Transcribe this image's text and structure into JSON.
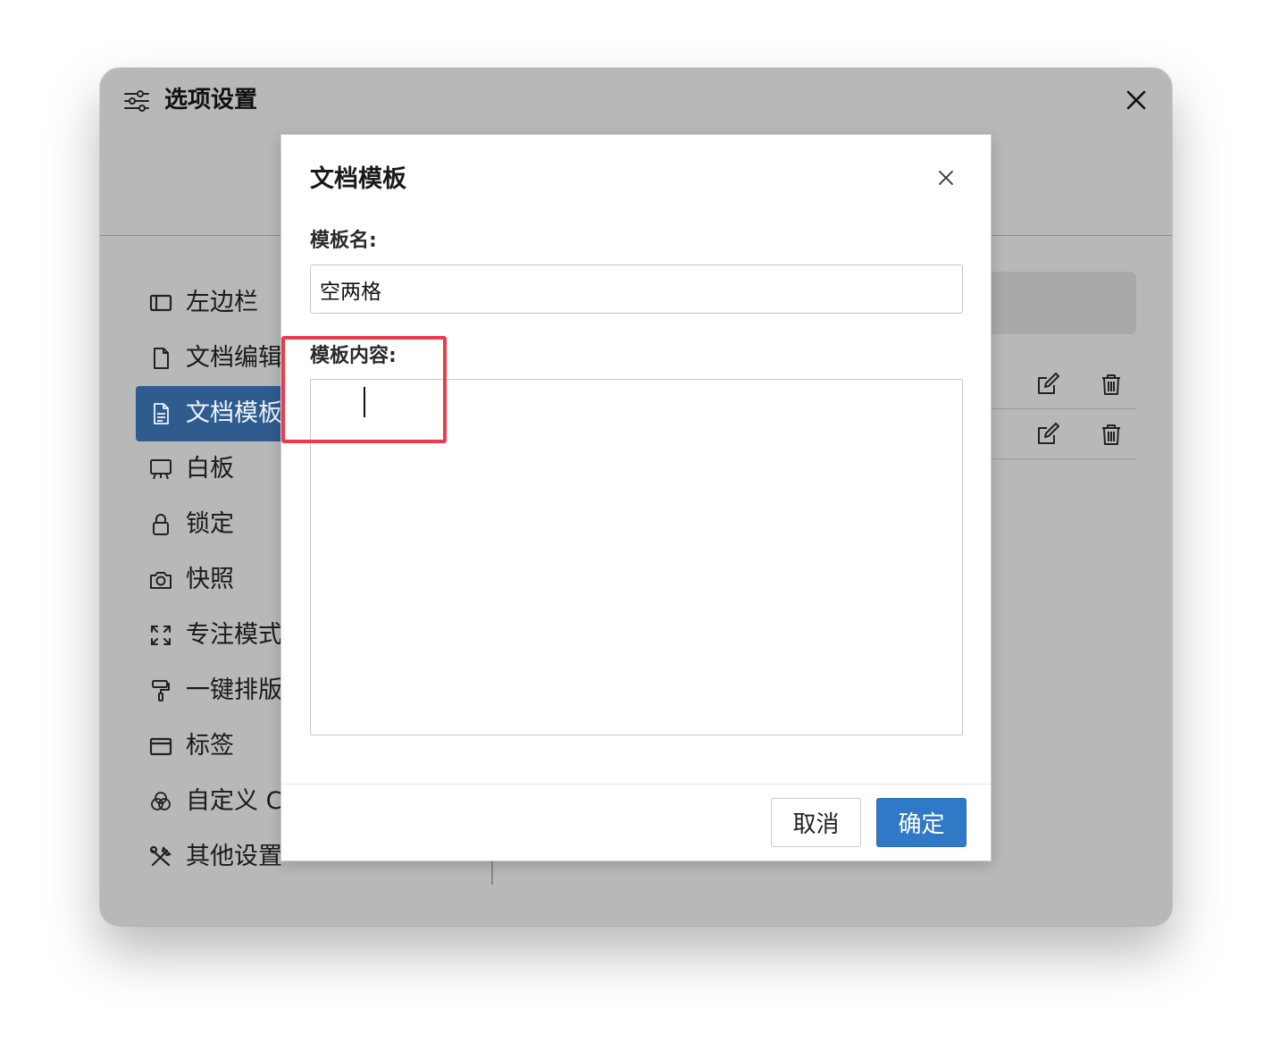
{
  "window": {
    "title": "选项设置",
    "title_icon": "sliders-icon",
    "close_icon": "close-icon"
  },
  "sidebar": {
    "items": [
      {
        "label": "左边栏",
        "icon": "sidebar-layout-icon"
      },
      {
        "label": "文档编辑",
        "icon": "file-icon"
      },
      {
        "label": "文档模板",
        "icon": "file-text-icon",
        "active": true
      },
      {
        "label": "白板",
        "icon": "whiteboard-icon"
      },
      {
        "label": "锁定",
        "icon": "lock-icon"
      },
      {
        "label": "快照",
        "icon": "camera-icon"
      },
      {
        "label": "专注模式",
        "icon": "expand-icon"
      },
      {
        "label": "一键排版",
        "icon": "paint-roller-icon"
      },
      {
        "label": "标签",
        "icon": "folder-icon"
      },
      {
        "label": "自定义 C",
        "icon": "circles-icon"
      },
      {
        "label": "其他设置",
        "icon": "tools-icon"
      }
    ]
  },
  "template_rows": [
    {
      "edit_icon": "edit-icon",
      "delete_icon": "trash-icon"
    },
    {
      "edit_icon": "edit-icon",
      "delete_icon": "trash-icon"
    }
  ],
  "dialog": {
    "title": "文档模板",
    "name_label": "模板名:",
    "name_value": "空两格",
    "content_label": "模板内容:",
    "content_value": "    ",
    "cancel_label": "取消",
    "ok_label": "确定"
  },
  "colors": {
    "accent": "#3079c6",
    "sidebar_active": "#2f5c8f",
    "highlight": "#f0394b",
    "overlay": "#b8b8b8"
  }
}
